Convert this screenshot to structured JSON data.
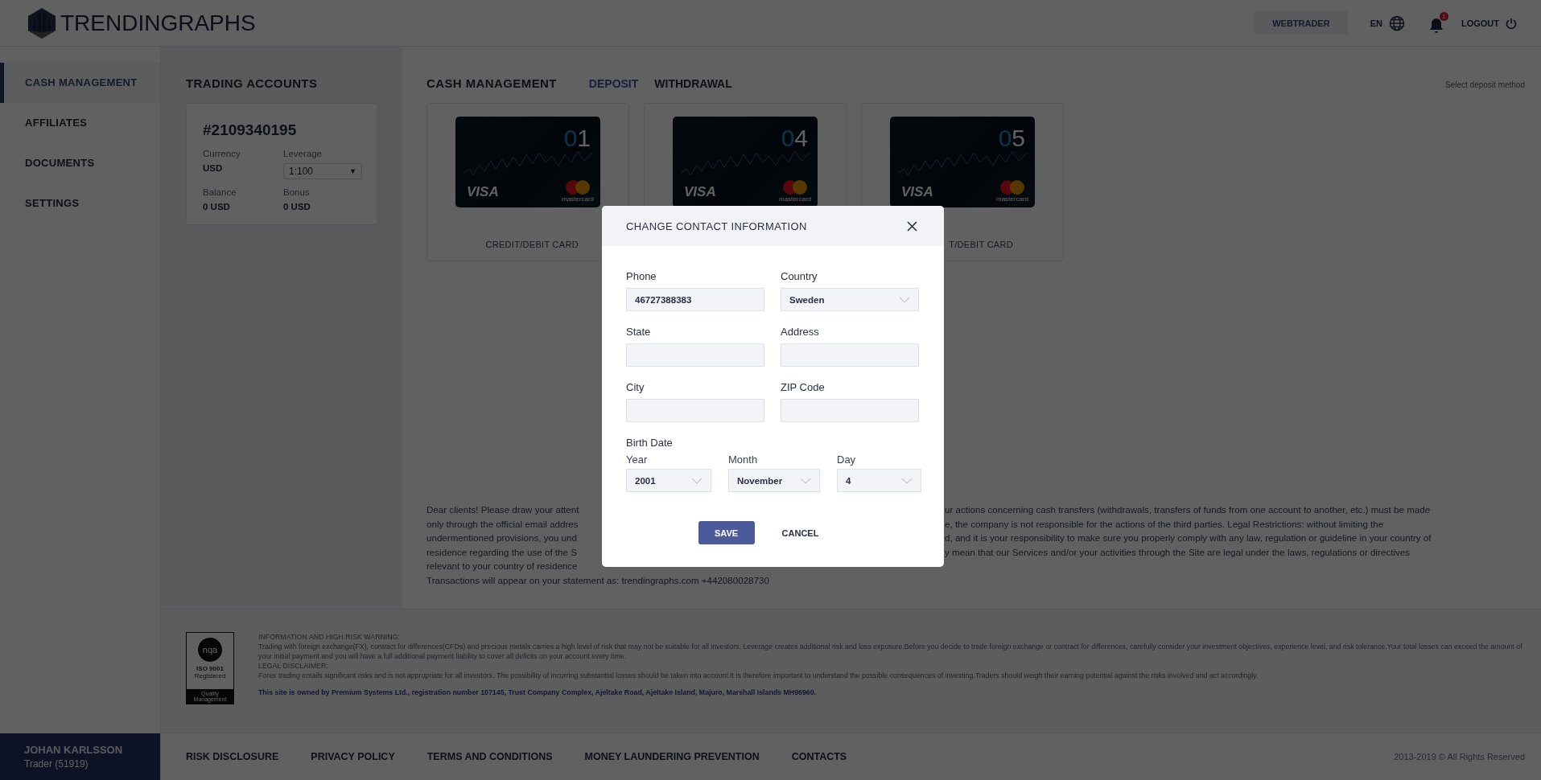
{
  "header": {
    "logo": "TRENDINGRAPHS",
    "webtrader": "WEBTRADER",
    "language": "EN",
    "notifications": "1",
    "logout": "LOGOUT"
  },
  "sidebar": {
    "items": [
      {
        "label": "CASH MANAGEMENT",
        "selected": true
      },
      {
        "label": "AFFILIATES",
        "selected": false
      },
      {
        "label": "DOCUMENTS",
        "selected": false
      },
      {
        "label": "SETTINGS",
        "selected": false
      }
    ],
    "user": {
      "name": "JOHAN KARLSSON",
      "role": "Trader (51919)"
    }
  },
  "trading_accounts": {
    "title": "TRADING ACCOUNTS",
    "account": {
      "number": "#2109340195",
      "currency_label": "Currency",
      "currency": "USD",
      "leverage_label": "Leverage",
      "leverage": "1:100",
      "leverage_caret": "▼",
      "balance_label": "Balance",
      "balance": "0 USD",
      "bonus_label": "Bonus",
      "bonus": "0 USD"
    }
  },
  "cash_management": {
    "title": "CASH MANAGEMENT",
    "tabs": [
      {
        "label": "DEPOSIT",
        "selected": true
      },
      {
        "label": "WITHDRAWAL",
        "selected": false
      }
    ],
    "hint": "Select deposit method",
    "methods": [
      {
        "number_lead": "0",
        "number_tail": "1",
        "brand": "VISA",
        "network": "mastercard",
        "label": "CREDIT/DEBIT CARD"
      },
      {
        "number_lead": "0",
        "number_tail": "4",
        "brand": "VISA",
        "network": "mastercard"
      },
      {
        "number_lead": "0",
        "number_tail": "5",
        "brand": "VISA",
        "network": "mastercard",
        "label": "T/DEBIT CARD"
      }
    ]
  },
  "notice": {
    "lines": [
      {
        "left": "Dear clients! Please draw your attent",
        "right": "ur actions concerning cash transfers (withdrawals, transfers of funds from one account to another, etc.) must be made"
      },
      {
        "left": "only through the official email addres",
        "right": "e, the company is not responsible for the actions of the third parties. Legal Restrictions: without limiting the"
      },
      {
        "left": "undermentioned provisions, you und",
        "right": "d, and it is your responsibility to make sure you properly comply with any law, regulation or guideline in your country of"
      },
      {
        "left": "residence regarding the use of the S",
        "right": "y mean that our Services and/or your activities through the Site are legal under the laws, regulations or directives"
      },
      {
        "left": "relevant to your country of residence"
      }
    ],
    "statement": "Transactions will appear on your statement as: trendingraphs.com +442080028730"
  },
  "footer": {
    "badge": {
      "brand": "nqa",
      "standard": "ISO 9001",
      "status": "Registered",
      "scope": "Quality Management"
    },
    "warning_title": "INFORMATION AND HIGH RISK WARNING:",
    "warning": "Trading with foreign exchange(FX), contract for differences(CFDs) and precious metals carries a high level of risk that may not be suitable for all investors. Leverage creates additional risk and loss exposure.Before you decide to trade foreign exchange or contract for differences, carefully consider your investment objectives, experience level, and risk tolerance.Your total losses can exceed the amount of your initial payment and you will have a full additional payment liability to cover all deficits on your account every time.",
    "disclaimer_title": "LEGAL DISCLAIMER:",
    "disclaimer": "Forex trading entails significant risks and is not appropriate for all investors. The possibility of incurring substantial losses should be taken into account.It is therefore important to understand the possible consequences of investing.Traders should weigh their earning potential against the risks involved and act accordingly.",
    "owner": "This site is owned by Premium Systems Ltd., registration number 107145, Trust Company Complex, Ajeltake Road, Ajeltake Island, Majuro, Marshall Islands MH96960.",
    "links": [
      "RISK DISCLOSURE",
      "PRIVACY POLICY",
      "TERMS AND CONDITIONS",
      "MONEY LAUNDERING PREVENTION",
      "CONTACTS"
    ],
    "copyright": "2013-2019 © All Rights Reserved"
  },
  "dialog": {
    "title": "CHANGE CONTACT INFORMATION",
    "fields": [
      {
        "label": "Phone",
        "value": "46727388383",
        "kind": "text"
      },
      {
        "label": "Country",
        "value": "Sweden",
        "kind": "select"
      },
      {
        "label": "State",
        "kind": "text"
      },
      {
        "label": "Address",
        "kind": "text"
      },
      {
        "label": "City",
        "kind": "text"
      },
      {
        "label": "ZIP Code",
        "kind": "text"
      }
    ],
    "birth_date": {
      "label": "Birth Date",
      "parts": [
        {
          "label": "Year",
          "value": "2001"
        },
        {
          "label": "Month",
          "value": "November"
        },
        {
          "label": "Day",
          "value": "4"
        }
      ]
    },
    "save": "SAVE",
    "cancel": "CANCEL"
  }
}
